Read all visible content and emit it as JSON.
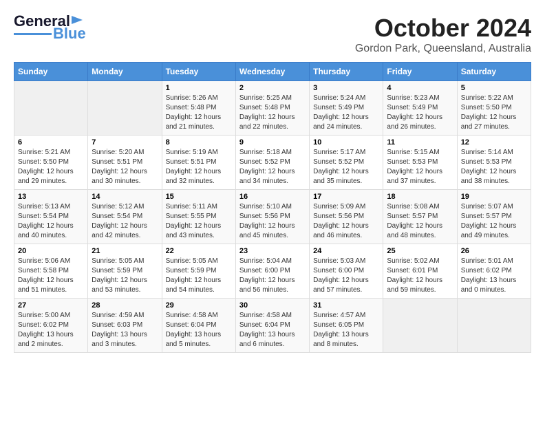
{
  "logo": {
    "line1": "General",
    "line2": "Blue"
  },
  "title": "October 2024",
  "subtitle": "Gordon Park, Queensland, Australia",
  "headers": [
    "Sunday",
    "Monday",
    "Tuesday",
    "Wednesday",
    "Thursday",
    "Friday",
    "Saturday"
  ],
  "weeks": [
    [
      {
        "num": "",
        "sunrise": "",
        "sunset": "",
        "daylight": ""
      },
      {
        "num": "",
        "sunrise": "",
        "sunset": "",
        "daylight": ""
      },
      {
        "num": "1",
        "sunrise": "Sunrise: 5:26 AM",
        "sunset": "Sunset: 5:48 PM",
        "daylight": "Daylight: 12 hours and 21 minutes."
      },
      {
        "num": "2",
        "sunrise": "Sunrise: 5:25 AM",
        "sunset": "Sunset: 5:48 PM",
        "daylight": "Daylight: 12 hours and 22 minutes."
      },
      {
        "num": "3",
        "sunrise": "Sunrise: 5:24 AM",
        "sunset": "Sunset: 5:49 PM",
        "daylight": "Daylight: 12 hours and 24 minutes."
      },
      {
        "num": "4",
        "sunrise": "Sunrise: 5:23 AM",
        "sunset": "Sunset: 5:49 PM",
        "daylight": "Daylight: 12 hours and 26 minutes."
      },
      {
        "num": "5",
        "sunrise": "Sunrise: 5:22 AM",
        "sunset": "Sunset: 5:50 PM",
        "daylight": "Daylight: 12 hours and 27 minutes."
      }
    ],
    [
      {
        "num": "6",
        "sunrise": "Sunrise: 5:21 AM",
        "sunset": "Sunset: 5:50 PM",
        "daylight": "Daylight: 12 hours and 29 minutes."
      },
      {
        "num": "7",
        "sunrise": "Sunrise: 5:20 AM",
        "sunset": "Sunset: 5:51 PM",
        "daylight": "Daylight: 12 hours and 30 minutes."
      },
      {
        "num": "8",
        "sunrise": "Sunrise: 5:19 AM",
        "sunset": "Sunset: 5:51 PM",
        "daylight": "Daylight: 12 hours and 32 minutes."
      },
      {
        "num": "9",
        "sunrise": "Sunrise: 5:18 AM",
        "sunset": "Sunset: 5:52 PM",
        "daylight": "Daylight: 12 hours and 34 minutes."
      },
      {
        "num": "10",
        "sunrise": "Sunrise: 5:17 AM",
        "sunset": "Sunset: 5:52 PM",
        "daylight": "Daylight: 12 hours and 35 minutes."
      },
      {
        "num": "11",
        "sunrise": "Sunrise: 5:15 AM",
        "sunset": "Sunset: 5:53 PM",
        "daylight": "Daylight: 12 hours and 37 minutes."
      },
      {
        "num": "12",
        "sunrise": "Sunrise: 5:14 AM",
        "sunset": "Sunset: 5:53 PM",
        "daylight": "Daylight: 12 hours and 38 minutes."
      }
    ],
    [
      {
        "num": "13",
        "sunrise": "Sunrise: 5:13 AM",
        "sunset": "Sunset: 5:54 PM",
        "daylight": "Daylight: 12 hours and 40 minutes."
      },
      {
        "num": "14",
        "sunrise": "Sunrise: 5:12 AM",
        "sunset": "Sunset: 5:54 PM",
        "daylight": "Daylight: 12 hours and 42 minutes."
      },
      {
        "num": "15",
        "sunrise": "Sunrise: 5:11 AM",
        "sunset": "Sunset: 5:55 PM",
        "daylight": "Daylight: 12 hours and 43 minutes."
      },
      {
        "num": "16",
        "sunrise": "Sunrise: 5:10 AM",
        "sunset": "Sunset: 5:56 PM",
        "daylight": "Daylight: 12 hours and 45 minutes."
      },
      {
        "num": "17",
        "sunrise": "Sunrise: 5:09 AM",
        "sunset": "Sunset: 5:56 PM",
        "daylight": "Daylight: 12 hours and 46 minutes."
      },
      {
        "num": "18",
        "sunrise": "Sunrise: 5:08 AM",
        "sunset": "Sunset: 5:57 PM",
        "daylight": "Daylight: 12 hours and 48 minutes."
      },
      {
        "num": "19",
        "sunrise": "Sunrise: 5:07 AM",
        "sunset": "Sunset: 5:57 PM",
        "daylight": "Daylight: 12 hours and 49 minutes."
      }
    ],
    [
      {
        "num": "20",
        "sunrise": "Sunrise: 5:06 AM",
        "sunset": "Sunset: 5:58 PM",
        "daylight": "Daylight: 12 hours and 51 minutes."
      },
      {
        "num": "21",
        "sunrise": "Sunrise: 5:05 AM",
        "sunset": "Sunset: 5:59 PM",
        "daylight": "Daylight: 12 hours and 53 minutes."
      },
      {
        "num": "22",
        "sunrise": "Sunrise: 5:05 AM",
        "sunset": "Sunset: 5:59 PM",
        "daylight": "Daylight: 12 hours and 54 minutes."
      },
      {
        "num": "23",
        "sunrise": "Sunrise: 5:04 AM",
        "sunset": "Sunset: 6:00 PM",
        "daylight": "Daylight: 12 hours and 56 minutes."
      },
      {
        "num": "24",
        "sunrise": "Sunrise: 5:03 AM",
        "sunset": "Sunset: 6:00 PM",
        "daylight": "Daylight: 12 hours and 57 minutes."
      },
      {
        "num": "25",
        "sunrise": "Sunrise: 5:02 AM",
        "sunset": "Sunset: 6:01 PM",
        "daylight": "Daylight: 12 hours and 59 minutes."
      },
      {
        "num": "26",
        "sunrise": "Sunrise: 5:01 AM",
        "sunset": "Sunset: 6:02 PM",
        "daylight": "Daylight: 13 hours and 0 minutes."
      }
    ],
    [
      {
        "num": "27",
        "sunrise": "Sunrise: 5:00 AM",
        "sunset": "Sunset: 6:02 PM",
        "daylight": "Daylight: 13 hours and 2 minutes."
      },
      {
        "num": "28",
        "sunrise": "Sunrise: 4:59 AM",
        "sunset": "Sunset: 6:03 PM",
        "daylight": "Daylight: 13 hours and 3 minutes."
      },
      {
        "num": "29",
        "sunrise": "Sunrise: 4:58 AM",
        "sunset": "Sunset: 6:04 PM",
        "daylight": "Daylight: 13 hours and 5 minutes."
      },
      {
        "num": "30",
        "sunrise": "Sunrise: 4:58 AM",
        "sunset": "Sunset: 6:04 PM",
        "daylight": "Daylight: 13 hours and 6 minutes."
      },
      {
        "num": "31",
        "sunrise": "Sunrise: 4:57 AM",
        "sunset": "Sunset: 6:05 PM",
        "daylight": "Daylight: 13 hours and 8 minutes."
      },
      {
        "num": "",
        "sunrise": "",
        "sunset": "",
        "daylight": ""
      },
      {
        "num": "",
        "sunrise": "",
        "sunset": "",
        "daylight": ""
      }
    ]
  ]
}
